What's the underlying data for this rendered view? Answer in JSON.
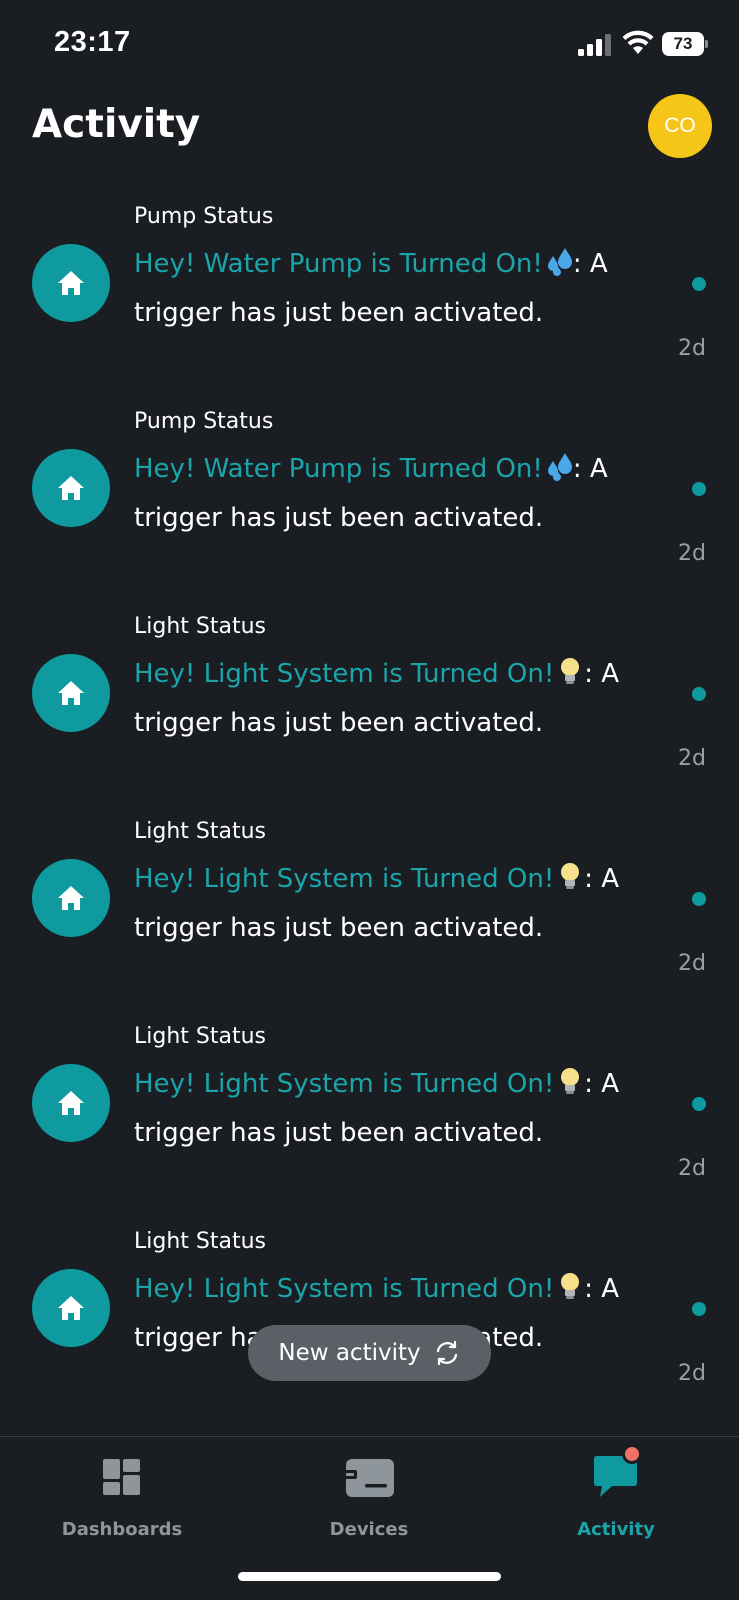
{
  "status_bar": {
    "time": "23:17",
    "battery": "73"
  },
  "header": {
    "title": "Activity",
    "avatar_initials": "CO",
    "avatar_color": "#f5c518"
  },
  "colors": {
    "accent": "#1aa5aa",
    "background": "#1a1d21",
    "icon_bg": "#0e9a9e",
    "badge": "#f07167"
  },
  "activities": [
    {
      "title": "Pump Status",
      "highlight": "Hey! Water Pump is Turned On!",
      "emoji": "droplets-emoji",
      "text_line1": ": A",
      "text_line2": "trigger has just been activated.",
      "time": "2d",
      "unread": true
    },
    {
      "title": "Pump Status",
      "highlight": "Hey! Water Pump is Turned On!",
      "emoji": "droplets-emoji",
      "text_line1": ": A",
      "text_line2": "trigger has just been activated.",
      "time": "2d",
      "unread": true
    },
    {
      "title": "Light Status",
      "highlight": "Hey! Light System is Turned On!",
      "emoji": "light-bulb-emoji",
      "text_line1": ": A",
      "text_line2": "trigger has just been activated.",
      "time": "2d",
      "unread": true
    },
    {
      "title": "Light Status",
      "highlight": "Hey! Light System is Turned On!",
      "emoji": "light-bulb-emoji",
      "text_line1": ": A",
      "text_line2": "trigger has just been activated.",
      "time": "2d",
      "unread": true
    },
    {
      "title": "Light Status",
      "highlight": "Hey! Light System is Turned On!",
      "emoji": "light-bulb-emoji",
      "text_line1": ": A",
      "text_line2": "trigger has just been activated.",
      "time": "2d",
      "unread": true
    },
    {
      "title": "Light Status",
      "highlight": "Hey! Light System is Turned On!",
      "emoji": "light-bulb-emoji",
      "text_line1": ": A",
      "text_line2": "trigger has just been activated.",
      "time": "2d",
      "unread": true
    }
  ],
  "toast": {
    "label": "New activity"
  },
  "tabs": [
    {
      "label": "Dashboards",
      "icon": "dashboards-icon",
      "active": false
    },
    {
      "label": "Devices",
      "icon": "devices-icon",
      "active": false
    },
    {
      "label": "Activity",
      "icon": "activity-icon",
      "active": true
    }
  ]
}
